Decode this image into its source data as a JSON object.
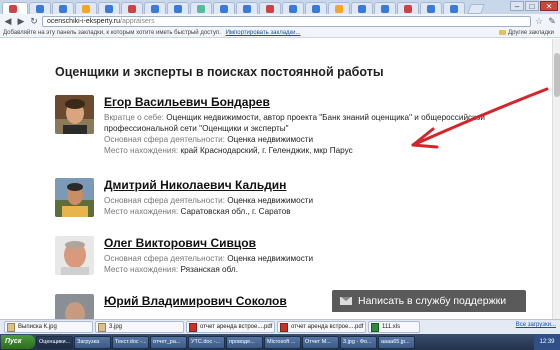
{
  "browser": {
    "url_host": "ocenschiki-i-eksperty.ru",
    "url_path": "/appraisers",
    "bookmarks_prompt": "Добавляйте на эту панель закладки, к которым хотите иметь быстрый доступ.",
    "bookmarks_import": "Импортировать закладки...",
    "other_bookmarks": "Другие закладки"
  },
  "page": {
    "heading": "Оценщики и эксперты в поисках постоянной работы",
    "label_about": "Вкратце о себе:",
    "label_activity": "Основная сфера деятельности:",
    "label_location": "Место нахождения:",
    "people": [
      {
        "name": "Егор Васильевич Бондарев",
        "about_line1": "Оценщик недвижимости, автор проекта \"Банк знаний оценщика\" и общероссийской",
        "about_line2": "профессиональной сети \"Оценщики и эксперты\"",
        "activity": "Оценка недвижимости",
        "location": "край Краснодарский, г. Геленджик, мкр Парус"
      },
      {
        "name": "Дмитрий Николаевич Кальдин",
        "activity": "Оценка недвижимости",
        "location": "Саратовская обл., г. Саратов"
      },
      {
        "name": "Олег Викторович Сивцов",
        "activity": "Оценка недвижимости",
        "location": "Рязанская обл."
      },
      {
        "name": "Юрий Владимирович Соколов"
      }
    ],
    "support_button": "Написать в службу поддержки"
  },
  "downloads": {
    "items": [
      {
        "name": "Выписка К.jpg",
        "type": "img"
      },
      {
        "name": "3.jpg",
        "type": "img"
      },
      {
        "name": "отчет аренда встрое....pdf",
        "type": "pdf"
      },
      {
        "name": "отчет аренда встрое....pdf",
        "type": "pdf"
      },
      {
        "name": "111.xls",
        "type": "xls"
      }
    ],
    "show_all": "Все загрузки..."
  },
  "taskbar": {
    "start_label": "Пуск",
    "items": [
      "Оценщики...",
      "Загрузка",
      "Текст.doc -...",
      "отчет_ра...",
      "УТС.doc -...",
      "проводе...",
      "Microsoft ...",
      "Отчет М...",
      "3.jpg - Фо...",
      "aaaa65.jp..."
    ],
    "active_index": 0,
    "clock": "12:39"
  }
}
